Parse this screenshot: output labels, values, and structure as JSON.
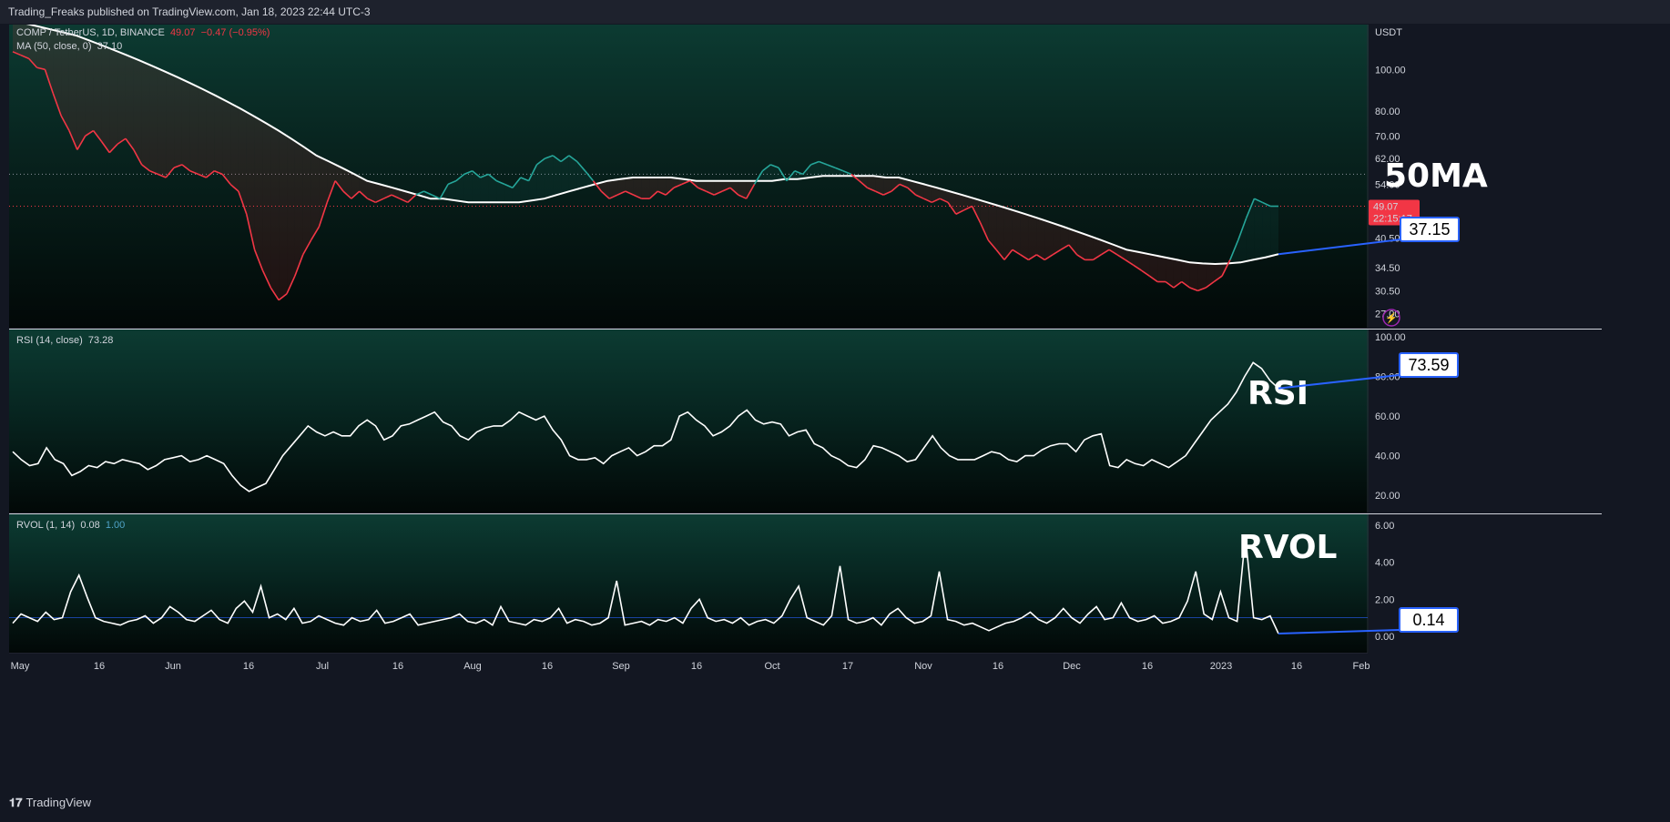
{
  "header": {
    "published": "Trading_Freaks published on TradingView.com, Jan 18, 2023 22:44 UTC-3"
  },
  "footer": {
    "brand": "TradingView"
  },
  "colors": {
    "up": "#26a69a",
    "down": "#f23645",
    "line": "#ffffff",
    "callout_border": "#2962ff",
    "price_tag": "#f23645"
  },
  "price_pane": {
    "legend_symbol": "COMP / TetherUS, 1D, BINANCE",
    "legend_close": "49.07",
    "legend_change": "−0.47 (−0.95%)",
    "legend_ma": "MA (50, close, 0)",
    "legend_ma_value": "37.10",
    "axis_currency": "USDT",
    "price_tag_value": "49.07",
    "price_tag_time": "22:15:17",
    "annotation": "50MA",
    "callout": "37.15"
  },
  "rsi_pane": {
    "legend_name": "RSI (14, close)",
    "legend_value": "73.28",
    "annotation": "RSI",
    "callout": "73.59"
  },
  "rvol_pane": {
    "legend_name": "RVOL (1, 14)",
    "legend_value": "0.08",
    "legend_value2": "1.00",
    "annotation": "RVOL",
    "callout": "0.14"
  },
  "chart_data": [
    {
      "type": "line",
      "title": "COMP / TetherUS, 1D, BINANCE",
      "scale": "log",
      "ylim": [
        26,
        120
      ],
      "yticks": [
        "100.00",
        "80.00",
        "70.00",
        "62.00",
        "54.00",
        "40.50",
        "34.50",
        "30.50",
        "27.00"
      ],
      "x_labels": [
        "May",
        "16",
        "Jun",
        "16",
        "Jul",
        "16",
        "Aug",
        "16",
        "Sep",
        "16",
        "Oct",
        "17",
        "Nov",
        "16",
        "Dec",
        "16",
        "2023",
        "16",
        "Feb"
      ],
      "series": [
        {
          "name": "COMP / TetherUS",
          "values": [
            110,
            108,
            106,
            101,
            100,
            88,
            78,
            72,
            65,
            70,
            72,
            68,
            64,
            67,
            69,
            65,
            60,
            58,
            57,
            56,
            59,
            60,
            58,
            57,
            56,
            58,
            57,
            54,
            52,
            46,
            38,
            34,
            31,
            29,
            30,
            33,
            37,
            40,
            43,
            49,
            55,
            52,
            50,
            52,
            50,
            49,
            50,
            51,
            50,
            49,
            51,
            52,
            51,
            50,
            54,
            55,
            57,
            58,
            56,
            57,
            55,
            54,
            53,
            56,
            55,
            60,
            62,
            63,
            61,
            63,
            61,
            58,
            55,
            52,
            50,
            51,
            52,
            51,
            50,
            50,
            52,
            51,
            53,
            54,
            55,
            53,
            52,
            51,
            52,
            53,
            51,
            50,
            54,
            58,
            60,
            59,
            55,
            58,
            57,
            60,
            61,
            60,
            59,
            58,
            57,
            55,
            53,
            52,
            51,
            52,
            54,
            53,
            51,
            50,
            49,
            50,
            49,
            46,
            47,
            48,
            44,
            40,
            38,
            36,
            38,
            37,
            36,
            37,
            36,
            37,
            38,
            39,
            37,
            36,
            36,
            37,
            38,
            37,
            36,
            35,
            34,
            33,
            32,
            32,
            31,
            32,
            31,
            30.5,
            31,
            32,
            33,
            36,
            40,
            45,
            50,
            49,
            48,
            48
          ]
        },
        {
          "name": "MA (50, close, 0)",
          "values": [
            130,
            128,
            126,
            124,
            122,
            120,
            117,
            114,
            111,
            108,
            105,
            102,
            99,
            96,
            93,
            90,
            87,
            84,
            81,
            78,
            75,
            72,
            69,
            66,
            63,
            61,
            59,
            57,
            55,
            54,
            53,
            52,
            51,
            50,
            50,
            49.5,
            49,
            49,
            49,
            49,
            49,
            49.5,
            50,
            51,
            52,
            53,
            54,
            55,
            55.5,
            56,
            56,
            56,
            56,
            55.5,
            55,
            55,
            55,
            55,
            55,
            55,
            55,
            55.5,
            55.5,
            56,
            56.5,
            56.5,
            56.5,
            56.5,
            56.5,
            56,
            56,
            55,
            54,
            53,
            52,
            51,
            50,
            49,
            48,
            47,
            46,
            45,
            44,
            43,
            42,
            41,
            40,
            39,
            38,
            37.5,
            37,
            36.5,
            36,
            35.5,
            35.3,
            35.2,
            35.3,
            35.5,
            36,
            36.5,
            37.1
          ]
        }
      ]
    },
    {
      "type": "line",
      "title": "RSI (14, close)",
      "ylim": [
        15,
        100
      ],
      "yticks": [
        "100.00",
        "80.00",
        "60.00",
        "40.00",
        "20.00"
      ],
      "series": [
        {
          "name": "RSI (14, close)",
          "values": [
            42,
            38,
            35,
            36,
            44,
            38,
            36,
            30,
            32,
            35,
            34,
            37,
            36,
            38,
            37,
            36,
            33,
            35,
            38,
            39,
            40,
            37,
            38,
            40,
            38,
            36,
            30,
            25,
            22,
            24,
            26,
            33,
            40,
            45,
            50,
            55,
            52,
            50,
            52,
            50,
            50,
            55,
            58,
            55,
            48,
            50,
            55,
            56,
            58,
            60,
            62,
            57,
            55,
            50,
            48,
            52,
            54,
            55,
            55,
            58,
            62,
            60,
            58,
            60,
            53,
            48,
            40,
            38,
            38,
            39,
            36,
            40,
            42,
            44,
            40,
            42,
            45,
            45,
            48,
            60,
            62,
            58,
            55,
            50,
            52,
            55,
            60,
            63,
            58,
            56,
            57,
            56,
            50,
            52,
            53,
            46,
            44,
            40,
            38,
            35,
            34,
            38,
            45,
            44,
            42,
            40,
            37,
            38,
            44,
            50,
            44,
            40,
            38,
            38,
            38,
            40,
            42,
            41,
            38,
            37,
            40,
            40,
            43,
            45,
            46,
            46,
            42,
            48,
            50,
            51,
            35,
            34,
            38,
            36,
            35,
            38,
            36,
            34,
            37,
            40,
            46,
            52,
            58,
            62,
            66,
            72,
            80,
            87,
            84,
            78,
            74
          ]
        }
      ]
    },
    {
      "type": "line",
      "title": "RVOL (1, 14)",
      "ylim": [
        -0.5,
        6.2
      ],
      "yticks": [
        "6.00",
        "4.00",
        "2.00",
        "0.00"
      ],
      "reference_line": 1.0,
      "series": [
        {
          "name": "RVOL (1, 14)",
          "values": [
            0.7,
            1.2,
            1.0,
            0.8,
            1.3,
            0.9,
            1.0,
            2.4,
            3.3,
            2.1,
            1.0,
            0.8,
            0.7,
            0.6,
            0.8,
            0.9,
            1.1,
            0.7,
            1.0,
            1.6,
            1.3,
            0.9,
            0.8,
            1.1,
            1.4,
            0.9,
            0.7,
            1.5,
            1.9,
            1.3,
            2.7,
            1.0,
            1.2,
            0.9,
            1.5,
            0.7,
            0.8,
            1.1,
            0.9,
            0.7,
            0.6,
            1.0,
            0.8,
            0.9,
            1.4,
            0.7,
            0.8,
            1.0,
            1.2,
            0.6,
            0.7,
            0.8,
            0.9,
            1.0,
            1.2,
            0.8,
            0.7,
            0.9,
            0.6,
            1.6,
            0.8,
            0.7,
            0.6,
            0.9,
            0.8,
            1.0,
            1.5,
            0.7,
            0.9,
            0.8,
            0.6,
            0.7,
            1.0,
            3.0,
            0.6,
            0.7,
            0.8,
            0.6,
            0.9,
            0.8,
            1.0,
            0.7,
            1.5,
            2.0,
            1.0,
            0.8,
            0.9,
            0.7,
            1.0,
            0.6,
            0.8,
            0.9,
            0.7,
            1.1,
            2.0,
            2.7,
            1.0,
            0.8,
            0.6,
            1.1,
            3.8,
            0.9,
            0.7,
            0.8,
            1.0,
            0.6,
            1.2,
            1.5,
            1.0,
            0.7,
            0.8,
            1.1,
            3.5,
            0.9,
            0.8,
            0.6,
            0.7,
            0.5,
            0.3,
            0.5,
            0.7,
            0.8,
            1.0,
            1.3,
            0.9,
            0.7,
            1.0,
            1.5,
            1.0,
            0.7,
            1.2,
            1.6,
            0.9,
            1.0,
            1.8,
            1.0,
            0.8,
            0.9,
            1.1,
            0.7,
            0.8,
            1.0,
            1.9,
            3.5,
            1.2,
            0.9,
            2.4,
            1.0,
            0.8,
            5.4,
            1.0,
            0.9,
            1.1,
            0.14
          ]
        }
      ]
    }
  ]
}
